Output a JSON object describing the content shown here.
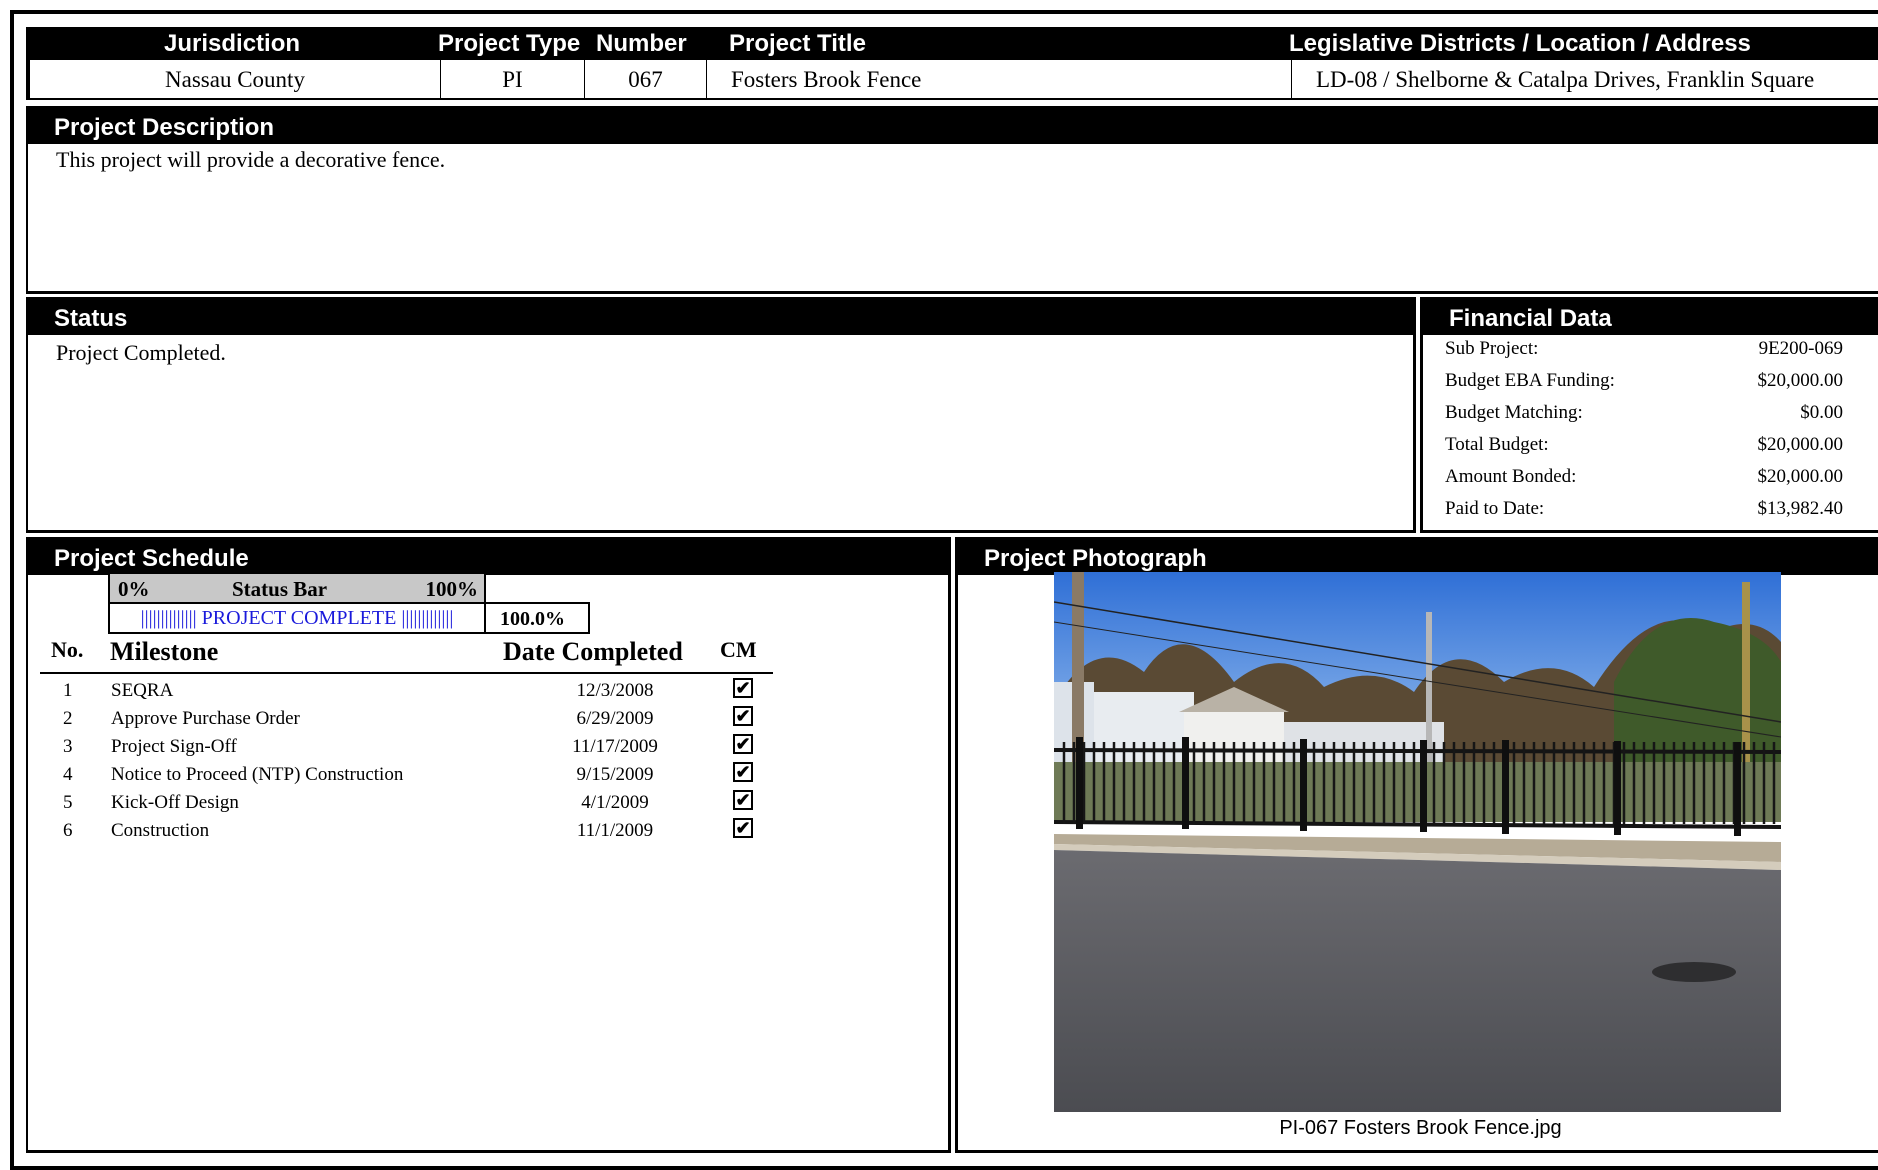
{
  "header": {
    "columns": [
      "Jurisdiction",
      "Project Type",
      "Number",
      "Project Title",
      "Legislative Districts / Location / Address"
    ],
    "values": [
      "Nassau County",
      "PI",
      "067",
      "Fosters Brook Fence",
      "LD-08 / Shelborne & Catalpa Drives, Franklin Square"
    ]
  },
  "description": {
    "title": "Project Description",
    "text": "This project will provide a decorative fence."
  },
  "status": {
    "title": "Status",
    "text": "Project Completed."
  },
  "financial": {
    "title": "Financial Data",
    "rows": [
      {
        "label": "Sub Project:",
        "value": "9E200-069"
      },
      {
        "label": "Budget EBA Funding:",
        "value": "$20,000.00"
      },
      {
        "label": "Budget Matching:",
        "value": "$0.00"
      },
      {
        "label": "Total Budget:",
        "value": "$20,000.00"
      },
      {
        "label": "Amount Bonded:",
        "value": "$20,000.00"
      },
      {
        "label": "Paid to Date:",
        "value": "$13,982.40"
      }
    ]
  },
  "schedule": {
    "title": "Project Schedule",
    "statusbar": {
      "min": "0%",
      "label": "Status Bar",
      "max": "100%"
    },
    "progress_text": "|||||||||||||| PROJECT COMPLETE |||||||||||||",
    "progress_pct": "100.0%",
    "progress_value": 1.0,
    "columns": {
      "no": "No.",
      "milestone": "Milestone",
      "date": "Date Completed",
      "cm": "CM"
    },
    "milestones": [
      {
        "no": "1",
        "name": "SEQRA",
        "date": "12/3/2008",
        "cm": true
      },
      {
        "no": "2",
        "name": "Approve Purchase Order",
        "date": "6/29/2009",
        "cm": true
      },
      {
        "no": "3",
        "name": "Project Sign-Off",
        "date": "11/17/2009",
        "cm": true
      },
      {
        "no": "4",
        "name": "Notice to Proceed (NTP) Construction",
        "date": "9/15/2009",
        "cm": true
      },
      {
        "no": "5",
        "name": "Kick-Off Design",
        "date": "4/1/2009",
        "cm": true
      },
      {
        "no": "6",
        "name": "Construction",
        "date": "11/1/2009",
        "cm": true
      }
    ]
  },
  "photo": {
    "title": "Project Photograph",
    "caption": "PI-067 Fosters Brook Fence.jpg"
  }
}
